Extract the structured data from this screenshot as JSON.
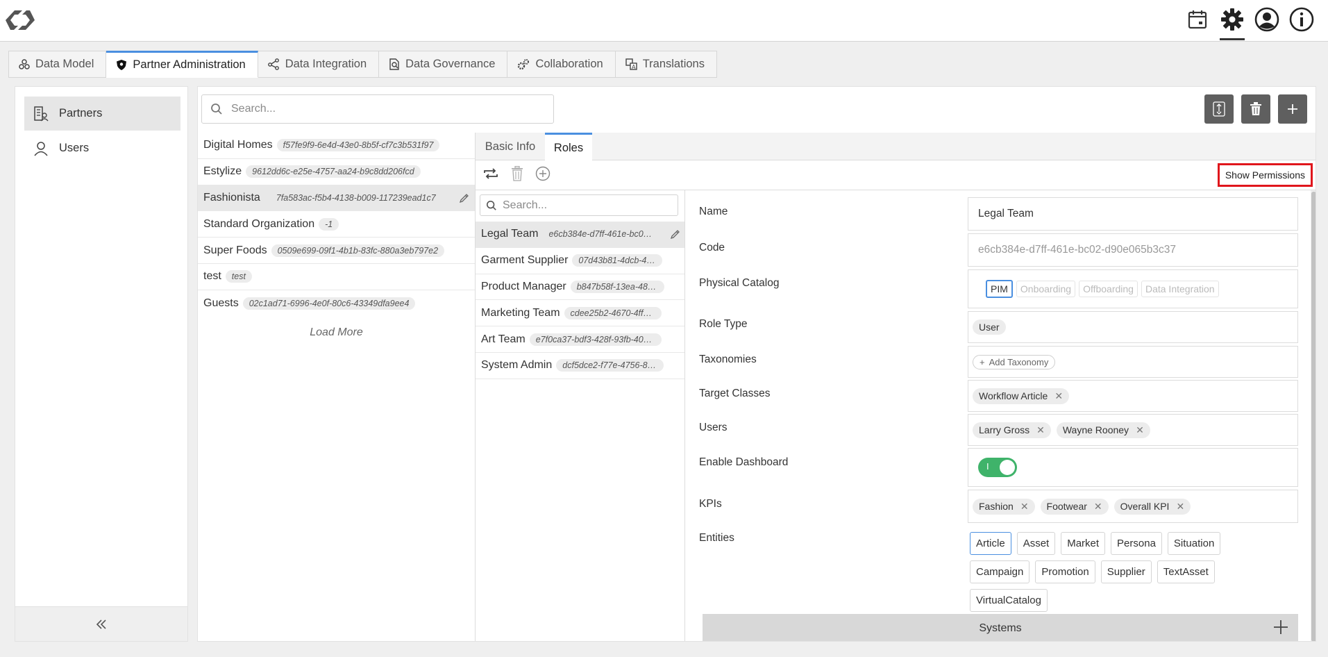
{
  "topbar": {
    "icons": [
      "logo-icon",
      "calendar-icon",
      "gear-icon",
      "user-icon",
      "info-icon"
    ]
  },
  "tabs": [
    {
      "label": "Data Model",
      "icon": "data-model-icon"
    },
    {
      "label": "Partner Administration",
      "icon": "shield-icon",
      "active": true
    },
    {
      "label": "Data Integration",
      "icon": "share-icon"
    },
    {
      "label": "Data Governance",
      "icon": "governance-icon"
    },
    {
      "label": "Collaboration",
      "icon": "gears-icon"
    },
    {
      "label": "Translations",
      "icon": "translate-icon"
    }
  ],
  "sidebar": {
    "items": [
      {
        "label": "Partners",
        "icon": "partners-icon",
        "active": true
      },
      {
        "label": "Users",
        "icon": "user-icon"
      }
    ]
  },
  "search": {
    "placeholder": "Search..."
  },
  "partners": [
    {
      "name": "Digital Homes",
      "id": "f57fe9f9-6e4d-43e0-8b5f-cf7c3b531f97"
    },
    {
      "name": "Estylize",
      "id": "9612dd6c-e25e-4757-aa24-b9c8dd206fcd"
    },
    {
      "name": "Fashionista",
      "id": "7fa583ac-f5b4-4138-b009-117239ead1c7",
      "active": true
    },
    {
      "name": "Standard Organization",
      "id": "-1"
    },
    {
      "name": "Super Foods",
      "id": "0509e699-09f1-4b1b-83fc-880a3eb797e2"
    },
    {
      "name": "test",
      "id": "test"
    },
    {
      "name": "Guests",
      "id": "02c1ad71-6996-4e0f-80c6-43349dfa9ee4"
    }
  ],
  "load_more": "Load More",
  "subtabs": {
    "basic_info": "Basic Info",
    "roles": "Roles"
  },
  "show_permissions": "Show Permissions",
  "roles_search": {
    "placeholder": "Search..."
  },
  "roles": [
    {
      "name": "Legal Team",
      "id": "e6cb384e-d7ff-461e-bc02-d...",
      "active": true
    },
    {
      "name": "Garment Supplier",
      "id": "07d43b81-4dcb-4e..."
    },
    {
      "name": "Product Manager",
      "id": "b847b58f-13ea-48d..."
    },
    {
      "name": "Marketing Team",
      "id": "cdee25b2-4670-4ffb-..."
    },
    {
      "name": "Art Team",
      "id": "e7f0ca37-bdf3-428f-93fb-40df..."
    },
    {
      "name": "System Admin",
      "id": "dcf5dce2-f77e-4756-8e..."
    }
  ],
  "form": {
    "labels": {
      "name": "Name",
      "code": "Code",
      "physical_catalog": "Physical Catalog",
      "role_type": "Role Type",
      "taxonomies": "Taxonomies",
      "target_classes": "Target Classes",
      "users": "Users",
      "enable_dashboard": "Enable Dashboard",
      "kpis": "KPIs",
      "entities": "Entities"
    },
    "name_value": "Legal Team",
    "code_value": "e6cb384e-d7ff-461e-bc02-d90e065b3c37",
    "catalogs": [
      "PIM",
      "Onboarding",
      "Offboarding",
      "Data Integration"
    ],
    "selected_catalog": "PIM",
    "role_type": "User",
    "add_taxonomy": "Add Taxonomy",
    "target_classes": [
      "Workflow Article"
    ],
    "users": [
      "Larry Gross",
      "Wayne Rooney"
    ],
    "dashboard_toggle_mark": "I",
    "dashboard_enabled": true,
    "kpis": [
      "Fashion",
      "Footwear",
      "Overall KPI"
    ],
    "entities": [
      "Article",
      "Asset",
      "Market",
      "Persona",
      "Situation",
      "Campaign",
      "Promotion",
      "Supplier",
      "TextAsset",
      "VirtualCatalog"
    ],
    "selected_entity": "Article",
    "systems": "Systems"
  },
  "colors": {
    "accent": "#4a8fe0",
    "toggle_on": "#3fb36a",
    "highlight": "#e0161c",
    "button": "#5f5f5f"
  }
}
